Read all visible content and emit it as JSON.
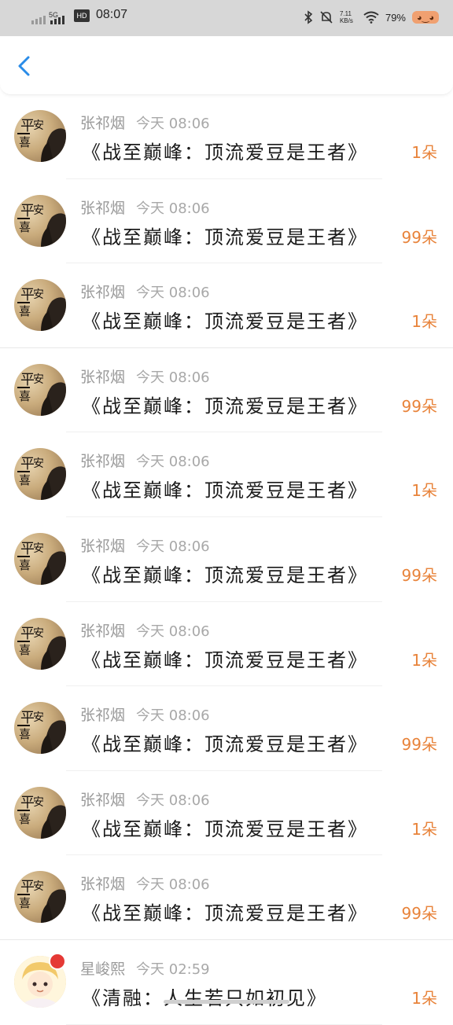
{
  "status_bar": {
    "time": "08:07",
    "network": "5G",
    "hd": "HD",
    "speed": "7.11 KB/s",
    "battery": "79%"
  },
  "header": {
    "back_icon": "chevron-left-icon"
  },
  "gifts": [
    {
      "sender": "张祁烟",
      "time": "今天 08:06",
      "title": "《战至巅峰：顶流爱豆是王者》",
      "amount": "1朵"
    },
    {
      "sender": "张祁烟",
      "time": "今天 08:06",
      "title": "《战至巅峰：顶流爱豆是王者》",
      "amount": "99朵"
    },
    {
      "sender": "张祁烟",
      "time": "今天 08:06",
      "title": "《战至巅峰：顶流爱豆是王者》",
      "amount": "1朵"
    },
    {
      "sender": "张祁烟",
      "time": "今天 08:06",
      "title": "《战至巅峰：顶流爱豆是王者》",
      "amount": "99朵"
    },
    {
      "sender": "张祁烟",
      "time": "今天 08:06",
      "title": "《战至巅峰：顶流爱豆是王者》",
      "amount": "1朵"
    },
    {
      "sender": "张祁烟",
      "time": "今天 08:06",
      "title": "《战至巅峰：顶流爱豆是王者》",
      "amount": "99朵"
    },
    {
      "sender": "张祁烟",
      "time": "今天 08:06",
      "title": "《战至巅峰：顶流爱豆是王者》",
      "amount": "1朵"
    },
    {
      "sender": "张祁烟",
      "time": "今天 08:06",
      "title": "《战至巅峰：顶流爱豆是王者》",
      "amount": "99朵"
    },
    {
      "sender": "张祁烟",
      "time": "今天 08:06",
      "title": "《战至巅峰：顶流爱豆是王者》",
      "amount": "1朵"
    },
    {
      "sender": "张祁烟",
      "time": "今天 08:06",
      "title": "《战至巅峰：顶流爱豆是王者》",
      "amount": "99朵"
    },
    {
      "sender": "星峻熙",
      "time": "今天 02:59",
      "title": "《清融：人生若只如初见》",
      "amount": "1朵"
    }
  ],
  "colors": {
    "accent": "#2a8ce8",
    "amount": "#e8833a",
    "status_bar_bg": "#d7d7d7"
  }
}
